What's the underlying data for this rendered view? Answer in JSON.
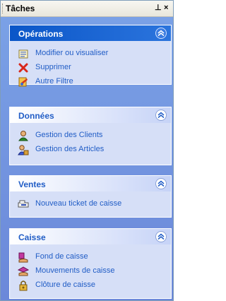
{
  "panel": {
    "title": "Tâches",
    "pin_glyph": "⊥",
    "close_glyph": "×"
  },
  "groups": [
    {
      "title": "Opérations",
      "items": [
        {
          "label": "Modifier ou visualiser",
          "icon": "edit-document-icon"
        },
        {
          "label": "Supprimer",
          "icon": "delete-x-icon"
        },
        {
          "label": "Autre Filtre",
          "icon": "filter-icon"
        }
      ]
    },
    {
      "title": "Données",
      "items": [
        {
          "label": "Gestion des Clients",
          "icon": "client-person-icon"
        },
        {
          "label": "Gestion des Articles",
          "icon": "articles-person-icon"
        }
      ]
    },
    {
      "title": "Ventes",
      "items": [
        {
          "label": "Nouveau ticket de caisse",
          "icon": "cash-ticket-icon"
        }
      ]
    },
    {
      "title": "Caisse",
      "items": [
        {
          "label": "Fond de caisse",
          "icon": "cash-fund-icon"
        },
        {
          "label": "Mouvements de caisse",
          "icon": "cash-movements-icon"
        },
        {
          "label": "Clôture de caisse",
          "icon": "cash-closing-icon"
        }
      ]
    }
  ],
  "colors": {
    "header_special": "#0a56c8",
    "link": "#215dc6",
    "body_bg": "#6b8fd8"
  }
}
